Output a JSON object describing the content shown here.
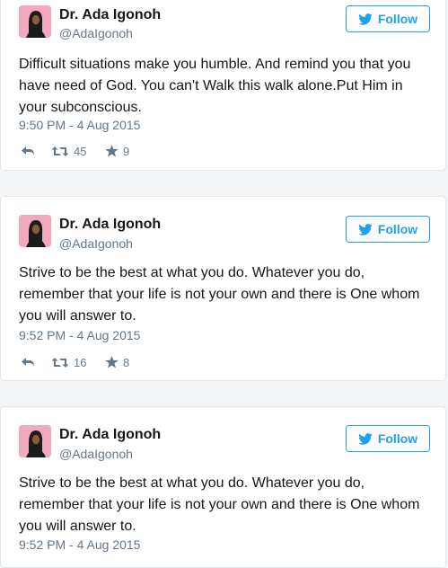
{
  "tweets": [
    {
      "name": "Dr. Ada Igonoh",
      "handle": "@AdaIgonoh",
      "follow_label": "Follow",
      "text": "Difficult situations make you humble. And remind you that you have need of God. You can't Walk this walk alone.Put Him in your subconscious.",
      "time": "9:50 PM - 4 Aug 2015",
      "retweets": "45",
      "likes": "9"
    },
    {
      "name": "Dr. Ada Igonoh",
      "handle": "@AdaIgonoh",
      "follow_label": "Follow",
      "text": "Strive to be the best at what you do. Whatever you do, remember that your life is not your own and there is One whom you will answer to.",
      "time": "9:52 PM - 4 Aug 2015",
      "retweets": "16",
      "likes": "8"
    },
    {
      "name": "Dr. Ada Igonoh",
      "handle": "@AdaIgonoh",
      "follow_label": "Follow",
      "text": "Strive to be the best at what you do. Whatever you do, remember that your life is not your own and there is One whom you will answer to.",
      "time": "9:52 PM - 4 Aug 2015"
    }
  ],
  "colors": {
    "twitter_blue": "#1da1f2",
    "text": "#14171a",
    "muted": "#657786",
    "avatar_bg": "#f2a8bd"
  }
}
